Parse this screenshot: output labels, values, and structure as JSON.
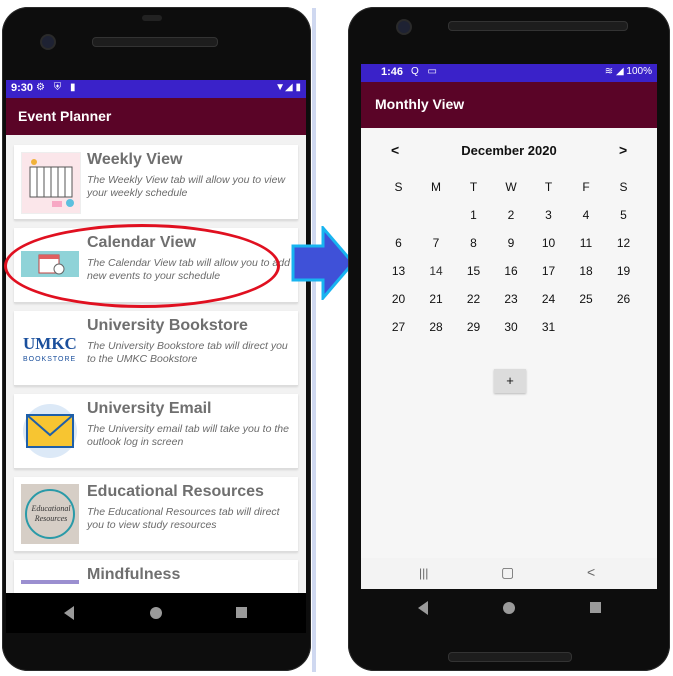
{
  "left_phone": {
    "status": {
      "time": "9:30"
    },
    "app_title": "Event Planner",
    "cards": [
      {
        "title": "Weekly View",
        "desc": "The Weekly View tab will allow you to view your weekly schedule",
        "thumb_icon": "weekly-planner-icon"
      },
      {
        "title": "Calendar View",
        "desc": "The Calendar View tab will allow you to add new events to your schedule",
        "thumb_icon": "calendar-icon"
      },
      {
        "title": "University Bookstore",
        "desc": "The University Bookstore tab will direct you to the UMKC Bookstore",
        "thumb_icon": "umkc-bookstore-logo",
        "thumb_text_1": "UMKC",
        "thumb_text_2": "BOOKSTORE"
      },
      {
        "title": "University Email",
        "desc": "The University email tab will take you to the outlook log in screen",
        "thumb_icon": "envelope-icon"
      },
      {
        "title": "Educational Resources",
        "desc": "The Educational Resources tab will direct you to view study resources",
        "thumb_icon": "educational-resources-icon",
        "thumb_text": "Educational Resources"
      },
      {
        "title": "Mindfulness",
        "thumb_icon": "mindfulness-icon"
      }
    ],
    "nav": {
      "back_icon": "back-triangle-icon",
      "home_icon": "home-circle-icon",
      "recents_icon": "recents-square-icon"
    }
  },
  "right_phone": {
    "status": {
      "time": "1:46",
      "battery": "100%"
    },
    "app_title": "Monthly View",
    "calendar": {
      "month_label": "December 2020",
      "prev": "<",
      "next": ">",
      "weekdays": [
        "S",
        "M",
        "T",
        "W",
        "T",
        "F",
        "S"
      ],
      "weeks": [
        [
          "",
          "",
          "1",
          "2",
          "3",
          "4",
          "5"
        ],
        [
          "6",
          "7",
          "8",
          "9",
          "10",
          "11",
          "12"
        ],
        [
          "13",
          "14",
          "15",
          "16",
          "17",
          "18",
          "19"
        ],
        [
          "20",
          "21",
          "22",
          "23",
          "24",
          "25",
          "26"
        ],
        [
          "27",
          "28",
          "29",
          "30",
          "31",
          "",
          ""
        ]
      ],
      "selected_day": "14",
      "add_label": "+"
    },
    "nav": {
      "recents_glyph": "|||",
      "home_glyph": "▢",
      "back_glyph": "<"
    }
  },
  "colors": {
    "status_bar": "#3a22c9",
    "app_bar": "#5a0427",
    "selected_day": "#1fd8c8",
    "arrow": "#3f51d8",
    "highlight_oval": "#e01020"
  }
}
